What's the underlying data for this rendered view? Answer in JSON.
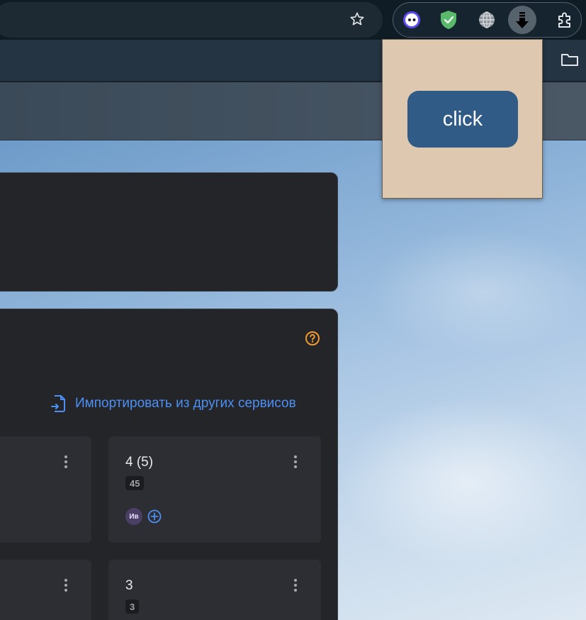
{
  "browser": {
    "toolbar_icons": [
      "star-icon",
      "folder-icon"
    ],
    "extensions": [
      "cat-face-extension-icon",
      "shield-check-extension-icon",
      "globe-extension-icon",
      "download-arrow-extension-icon",
      "puzzle-extensions-icon"
    ]
  },
  "popup": {
    "button_label": "click",
    "background": "#dec9b0",
    "button_color": "#2f5b86"
  },
  "main": {
    "import_label": "Импортировать из других сервисов",
    "accent": "#4d8ff2",
    "help_color": "#f29a2e",
    "cards": [
      {
        "title": "4 (5)",
        "count": "45",
        "avatar": "Ив"
      },
      {
        "title": "3",
        "count": "3"
      }
    ]
  }
}
